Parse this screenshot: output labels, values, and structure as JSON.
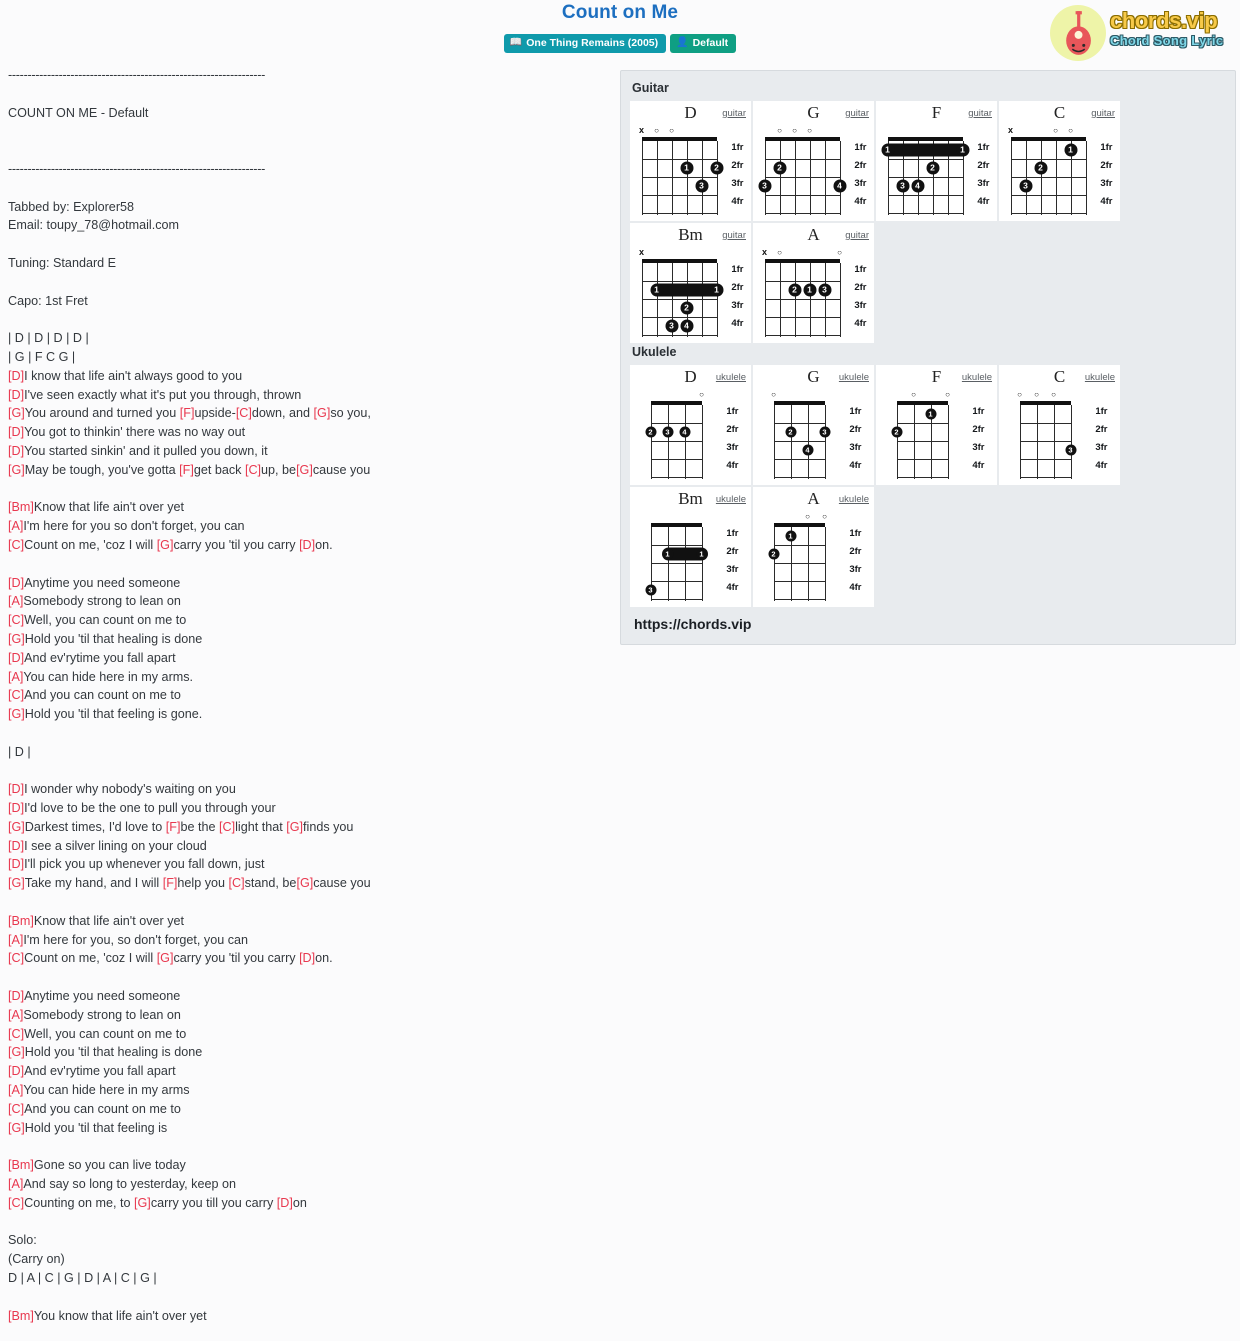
{
  "header": {
    "title": "Count on Me",
    "badges": [
      {
        "icon": "book-icon",
        "label": "One Thing Remains (2005)"
      },
      {
        "icon": "user-icon",
        "label": "Default"
      }
    ],
    "logo": {
      "main": "chords.vip",
      "sub": "Chord Song Lyric",
      "icon": "guitar-icon"
    }
  },
  "lyrics": {
    "lines": [
      {
        "text": "------------------------------------------------------------------"
      },
      {
        "text": ""
      },
      {
        "text": "COUNT ON ME - Default"
      },
      {
        "text": ""
      },
      {
        "text": ""
      },
      {
        "text": "------------------------------------------------------------------"
      },
      {
        "text": ""
      },
      {
        "text": "Tabbed by: Explorer58"
      },
      {
        "text": "Email: toupy_78@hotmail.com"
      },
      {
        "text": ""
      },
      {
        "text": "Tuning: Standard E"
      },
      {
        "text": ""
      },
      {
        "text": "Capo: 1st Fret"
      },
      {
        "text": ""
      },
      {
        "text": "| D | D | D | D |"
      },
      {
        "text": "| G | F C G |"
      },
      {
        "parts": [
          [
            "c",
            "D"
          ],
          [
            "t",
            "I know that life ain't always good to you"
          ]
        ]
      },
      {
        "parts": [
          [
            "c",
            "D"
          ],
          [
            "t",
            "I've seen exactly what it's put you through, thrown"
          ]
        ]
      },
      {
        "parts": [
          [
            "c",
            "G"
          ],
          [
            "t",
            "You around and turned you "
          ],
          [
            "c",
            "F"
          ],
          [
            "t",
            "upside-"
          ],
          [
            "c",
            "C"
          ],
          [
            "t",
            "down, and "
          ],
          [
            "c",
            "G"
          ],
          [
            "t",
            "so you,"
          ]
        ]
      },
      {
        "parts": [
          [
            "c",
            "D"
          ],
          [
            "t",
            "You got to thinkin' there was no way out"
          ]
        ]
      },
      {
        "parts": [
          [
            "c",
            "D"
          ],
          [
            "t",
            "You started sinkin' and it pulled you down, it"
          ]
        ]
      },
      {
        "parts": [
          [
            "c",
            "G"
          ],
          [
            "t",
            "May be tough, you've gotta "
          ],
          [
            "c",
            "F"
          ],
          [
            "t",
            "get back "
          ],
          [
            "c",
            "C"
          ],
          [
            "t",
            "up, be"
          ],
          [
            "c",
            "G"
          ],
          [
            "t",
            "cause you"
          ]
        ]
      },
      {
        "text": ""
      },
      {
        "parts": [
          [
            "c",
            "Bm"
          ],
          [
            "t",
            "Know that life ain't over yet"
          ]
        ]
      },
      {
        "parts": [
          [
            "c",
            "A"
          ],
          [
            "t",
            "I'm here for you so don't forget, you can"
          ]
        ]
      },
      {
        "parts": [
          [
            "c",
            "C"
          ],
          [
            "t",
            "Count on me, 'coz I will "
          ],
          [
            "c",
            "G"
          ],
          [
            "t",
            "carry you 'til you carry "
          ],
          [
            "c",
            "D"
          ],
          [
            "t",
            "on."
          ]
        ]
      },
      {
        "text": ""
      },
      {
        "parts": [
          [
            "c",
            "D"
          ],
          [
            "t",
            "Anytime you need someone"
          ]
        ]
      },
      {
        "parts": [
          [
            "c",
            "A"
          ],
          [
            "t",
            "Somebody strong to lean on"
          ]
        ]
      },
      {
        "parts": [
          [
            "c",
            "C"
          ],
          [
            "t",
            "Well, you can count on me to"
          ]
        ]
      },
      {
        "parts": [
          [
            "c",
            "G"
          ],
          [
            "t",
            "Hold you 'til that healing is done"
          ]
        ]
      },
      {
        "parts": [
          [
            "c",
            "D"
          ],
          [
            "t",
            "And ev'rytime you fall apart"
          ]
        ]
      },
      {
        "parts": [
          [
            "c",
            "A"
          ],
          [
            "t",
            "You can hide here in my arms."
          ]
        ]
      },
      {
        "parts": [
          [
            "c",
            "C"
          ],
          [
            "t",
            "And you can count on me to"
          ]
        ]
      },
      {
        "parts": [
          [
            "c",
            "G"
          ],
          [
            "t",
            "Hold you 'til that feeling is gone."
          ]
        ]
      },
      {
        "text": ""
      },
      {
        "text": "| D |"
      },
      {
        "text": ""
      },
      {
        "parts": [
          [
            "c",
            "D"
          ],
          [
            "t",
            "I wonder why nobody's waiting on you"
          ]
        ]
      },
      {
        "parts": [
          [
            "c",
            "D"
          ],
          [
            "t",
            "I'd love to be the one to pull you through your"
          ]
        ]
      },
      {
        "parts": [
          [
            "c",
            "G"
          ],
          [
            "t",
            "Darkest times, I'd love to "
          ],
          [
            "c",
            "F"
          ],
          [
            "t",
            "be the "
          ],
          [
            "c",
            "C"
          ],
          [
            "t",
            "light that "
          ],
          [
            "c",
            "G"
          ],
          [
            "t",
            "finds you"
          ]
        ]
      },
      {
        "parts": [
          [
            "c",
            "D"
          ],
          [
            "t",
            "I see a silver lining on your cloud"
          ]
        ]
      },
      {
        "parts": [
          [
            "c",
            "D"
          ],
          [
            "t",
            "I'll pick you up whenever you fall down, just"
          ]
        ]
      },
      {
        "parts": [
          [
            "c",
            "G"
          ],
          [
            "t",
            "Take my hand, and I will "
          ],
          [
            "c",
            "F"
          ],
          [
            "t",
            "help you "
          ],
          [
            "c",
            "C"
          ],
          [
            "t",
            "stand, be"
          ],
          [
            "c",
            "G"
          ],
          [
            "t",
            "cause you"
          ]
        ]
      },
      {
        "text": ""
      },
      {
        "parts": [
          [
            "c",
            "Bm"
          ],
          [
            "t",
            "Know that life ain't over yet"
          ]
        ]
      },
      {
        "parts": [
          [
            "c",
            "A"
          ],
          [
            "t",
            "I'm here for you, so don't forget, you can"
          ]
        ]
      },
      {
        "parts": [
          [
            "c",
            "C"
          ],
          [
            "t",
            "Count on me, 'coz I will "
          ],
          [
            "c",
            "G"
          ],
          [
            "t",
            "carry you 'til you carry "
          ],
          [
            "c",
            "D"
          ],
          [
            "t",
            "on."
          ]
        ]
      },
      {
        "text": ""
      },
      {
        "parts": [
          [
            "c",
            "D"
          ],
          [
            "t",
            "Anytime you need someone"
          ]
        ]
      },
      {
        "parts": [
          [
            "c",
            "A"
          ],
          [
            "t",
            "Somebody strong to lean on"
          ]
        ]
      },
      {
        "parts": [
          [
            "c",
            "C"
          ],
          [
            "t",
            "Well, you can count on me to"
          ]
        ]
      },
      {
        "parts": [
          [
            "c",
            "G"
          ],
          [
            "t",
            "Hold you 'til that healing is done"
          ]
        ]
      },
      {
        "parts": [
          [
            "c",
            "D"
          ],
          [
            "t",
            "And ev'rytime you fall apart"
          ]
        ]
      },
      {
        "parts": [
          [
            "c",
            "A"
          ],
          [
            "t",
            "You can hide here in my arms"
          ]
        ]
      },
      {
        "parts": [
          [
            "c",
            "C"
          ],
          [
            "t",
            "And you can count on me to"
          ]
        ]
      },
      {
        "parts": [
          [
            "c",
            "G"
          ],
          [
            "t",
            "Hold you 'til that feeling is"
          ]
        ]
      },
      {
        "text": ""
      },
      {
        "parts": [
          [
            "c",
            "Bm"
          ],
          [
            "t",
            "Gone so you can live today"
          ]
        ]
      },
      {
        "parts": [
          [
            "c",
            "A"
          ],
          [
            "t",
            "And say so long to yesterday, keep on"
          ]
        ]
      },
      {
        "parts": [
          [
            "c",
            "C"
          ],
          [
            "t",
            "Counting on me, to "
          ],
          [
            "c",
            "G"
          ],
          [
            "t",
            "carry you till you carry "
          ],
          [
            "c",
            "D"
          ],
          [
            "t",
            "on"
          ]
        ]
      },
      {
        "text": ""
      },
      {
        "text": "Solo:"
      },
      {
        "text": "(Carry on)"
      },
      {
        "text": "D | A | C | G | D | A | C | G |"
      },
      {
        "text": ""
      },
      {
        "parts": [
          [
            "c",
            "Bm"
          ],
          [
            "t",
            "You know that life ain't over yet"
          ]
        ]
      }
    ]
  },
  "chord_panel": {
    "sections": [
      {
        "heading": "Guitar",
        "instrument_label": "guitar",
        "strings": 6,
        "fret_labels": [
          "1fr",
          "2fr",
          "3fr",
          "4fr"
        ],
        "chords": [
          {
            "name": "D",
            "open": [
              "x",
              "o",
              "o",
              "",
              "",
              ""
            ],
            "dots": [
              {
                "s": 3,
                "f": 2,
                "n": "1"
              },
              {
                "s": 1,
                "f": 2,
                "n": "2"
              },
              {
                "s": 2,
                "f": 3,
                "n": "3"
              }
            ],
            "barre": null
          },
          {
            "name": "G",
            "open": [
              "",
              "o",
              "o",
              "o",
              "",
              ""
            ],
            "dots": [
              {
                "s": 5,
                "f": 2,
                "n": "2"
              },
              {
                "s": 6,
                "f": 3,
                "n": "3"
              },
              {
                "s": 1,
                "f": 3,
                "n": "4"
              }
            ],
            "barre": null
          },
          {
            "name": "F",
            "open": [
              "",
              "",
              "",
              "",
              "",
              ""
            ],
            "dots": [
              {
                "s": 3,
                "f": 2,
                "n": "2"
              },
              {
                "s": 5,
                "f": 3,
                "n": "3"
              },
              {
                "s": 4,
                "f": 3,
                "n": "4"
              }
            ],
            "barre": {
              "f": 1,
              "from": 6,
              "to": 1,
              "n": "1"
            }
          },
          {
            "name": "C",
            "open": [
              "x",
              "",
              "",
              "o",
              "o",
              ""
            ],
            "dots": [
              {
                "s": 2,
                "f": 1,
                "n": "1"
              },
              {
                "s": 4,
                "f": 2,
                "n": "2"
              },
              {
                "s": 5,
                "f": 3,
                "n": "3"
              }
            ],
            "barre": null
          },
          {
            "name": "Bm",
            "open": [
              "x",
              "",
              "",
              "",
              "",
              ""
            ],
            "dots": [
              {
                "s": 3,
                "f": 3,
                "n": "2"
              },
              {
                "s": 4,
                "f": 4,
                "n": "3"
              },
              {
                "s": 3,
                "f": 4,
                "n": "4"
              }
            ],
            "barre": {
              "f": 2,
              "from": 5,
              "to": 1,
              "n": "1"
            }
          },
          {
            "name": "A",
            "open": [
              "x",
              "o",
              "",
              "",
              "",
              "o"
            ],
            "dots": [
              {
                "s": 4,
                "f": 2,
                "n": "2"
              },
              {
                "s": 3,
                "f": 2,
                "n": "1"
              },
              {
                "s": 2,
                "f": 2,
                "n": "3"
              }
            ],
            "barre": null
          }
        ]
      },
      {
        "heading": "Ukulele",
        "instrument_label": "ukulele",
        "strings": 4,
        "fret_labels": [
          "1fr",
          "2fr",
          "3fr",
          "4fr"
        ],
        "chords": [
          {
            "name": "D",
            "open": [
              "",
              "",
              "",
              "o"
            ],
            "dots": [
              {
                "s": 4,
                "f": 2,
                "n": "2"
              },
              {
                "s": 3,
                "f": 2,
                "n": "3"
              },
              {
                "s": 2,
                "f": 2,
                "n": "4"
              }
            ],
            "barre": null
          },
          {
            "name": "G",
            "open": [
              "o",
              "",
              "",
              ""
            ],
            "dots": [
              {
                "s": 3,
                "f": 2,
                "n": "2"
              },
              {
                "s": 1,
                "f": 2,
                "n": "3"
              },
              {
                "s": 2,
                "f": 3,
                "n": "4"
              }
            ],
            "barre": null
          },
          {
            "name": "F",
            "open": [
              "",
              "o",
              "",
              "o"
            ],
            "dots": [
              {
                "s": 2,
                "f": 1,
                "n": "1"
              },
              {
                "s": 4,
                "f": 2,
                "n": "2"
              }
            ],
            "barre": null
          },
          {
            "name": "C",
            "open": [
              "o",
              "o",
              "o",
              ""
            ],
            "dots": [
              {
                "s": 1,
                "f": 3,
                "n": "3"
              }
            ],
            "barre": null
          },
          {
            "name": "Bm",
            "open": [
              "",
              "",
              "",
              ""
            ],
            "dots": [
              {
                "s": 4,
                "f": 4,
                "n": "3"
              }
            ],
            "barre": {
              "f": 2,
              "from": 3,
              "to": 1,
              "n": "1"
            }
          },
          {
            "name": "A",
            "open": [
              "",
              "",
              "o",
              "o"
            ],
            "dots": [
              {
                "s": 3,
                "f": 1,
                "n": "1"
              },
              {
                "s": 4,
                "f": 2,
                "n": "2"
              }
            ],
            "barre": null
          }
        ]
      }
    ],
    "site_url": "https://chords.vip"
  }
}
